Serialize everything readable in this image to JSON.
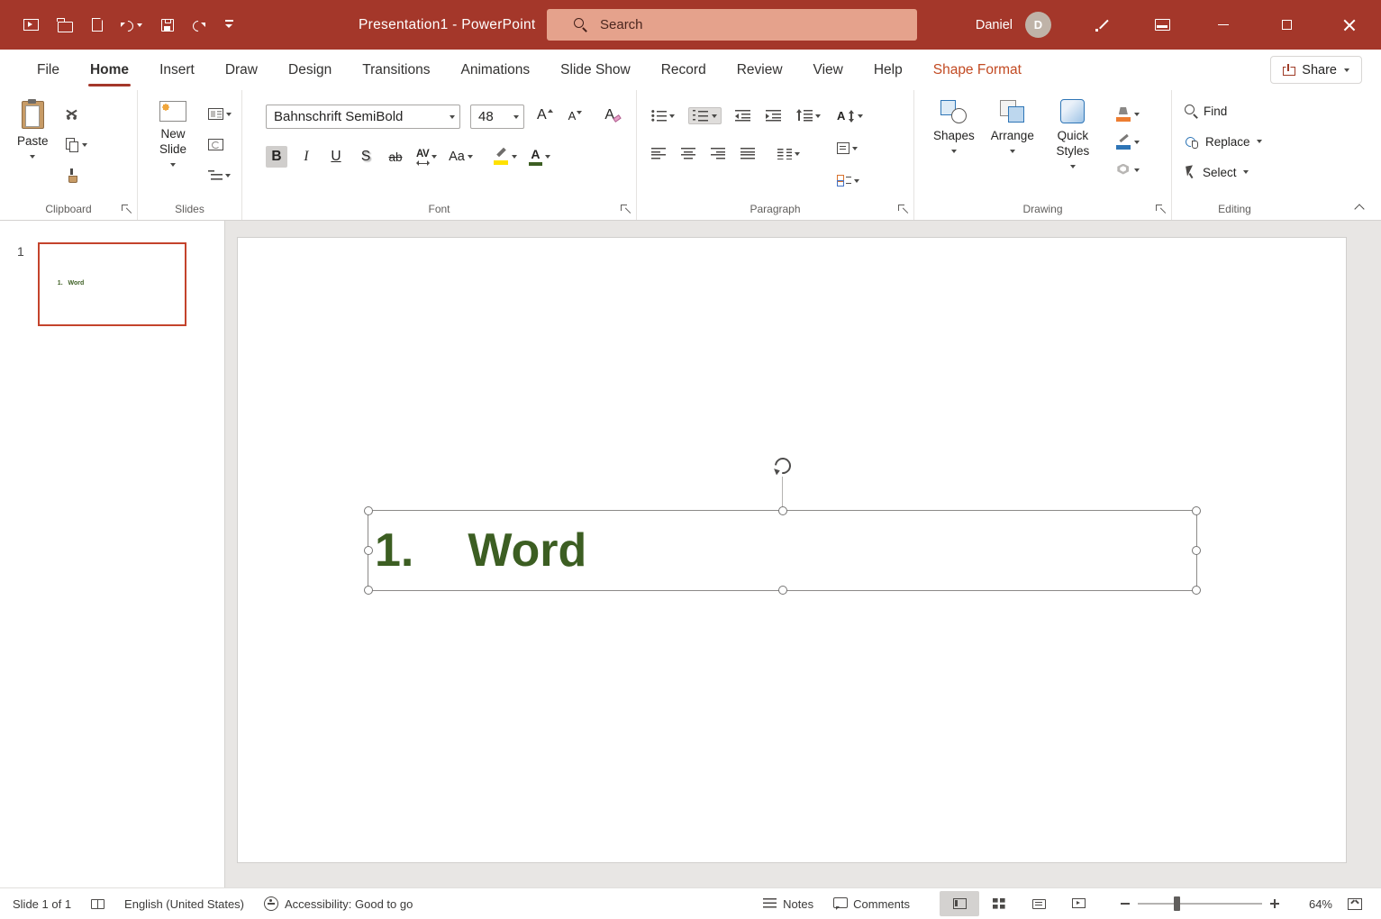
{
  "titlebar": {
    "title": "Presentation1 - PowerPoint",
    "search_placeholder": "Search",
    "user_name": "Daniel",
    "avatar_initial": "D"
  },
  "tabs": {
    "items": [
      {
        "label": "File"
      },
      {
        "label": "Home"
      },
      {
        "label": "Insert"
      },
      {
        "label": "Draw"
      },
      {
        "label": "Design"
      },
      {
        "label": "Transitions"
      },
      {
        "label": "Animations"
      },
      {
        "label": "Slide Show"
      },
      {
        "label": "Record"
      },
      {
        "label": "Review"
      },
      {
        "label": "View"
      },
      {
        "label": "Help"
      },
      {
        "label": "Shape Format"
      }
    ],
    "share_label": "Share"
  },
  "ribbon": {
    "clipboard": {
      "group_label": "Clipboard",
      "paste_label": "Paste"
    },
    "slides": {
      "group_label": "Slides",
      "new_slide_label": "New Slide"
    },
    "font": {
      "group_label": "Font",
      "font_name": "Bahnschrift SemiBold",
      "font_size": "48",
      "letter_a": "A",
      "bold_label": "B",
      "italic_label": "I",
      "underline_label": "U",
      "shadow_label": "S",
      "strikethrough_label": "ab",
      "spacing_label": "AV",
      "case_label": "Aa"
    },
    "paragraph": {
      "group_label": "Paragraph"
    },
    "drawing": {
      "group_label": "Drawing",
      "shapes_label": "Shapes",
      "arrange_label": "Arrange",
      "quick_styles_label": "Quick Styles"
    },
    "editing": {
      "group_label": "Editing",
      "find_label": "Find",
      "replace_label": "Replace",
      "select_label": "Select"
    }
  },
  "slides_panel": {
    "slide_number": "1",
    "thumbnail_text": "1.   Word"
  },
  "slide": {
    "list_number": "1.",
    "text": "Word"
  },
  "statusbar": {
    "slide_indicator": "Slide 1 of 1",
    "language": "English (United States)",
    "accessibility": "Accessibility: Good to go",
    "notes_label": "Notes",
    "comments_label": "Comments",
    "zoom_level": "64%"
  },
  "colors": {
    "titlebar_red": "#A4372A",
    "contextual_tab_orange": "#C24A22",
    "text_green": "#3C5E22",
    "highlight_yellow": "#FFE100",
    "fill_orange": "#ED7D31",
    "outline_blue": "#2E75B6",
    "thumbnail_selected_border": "#C4432C"
  }
}
